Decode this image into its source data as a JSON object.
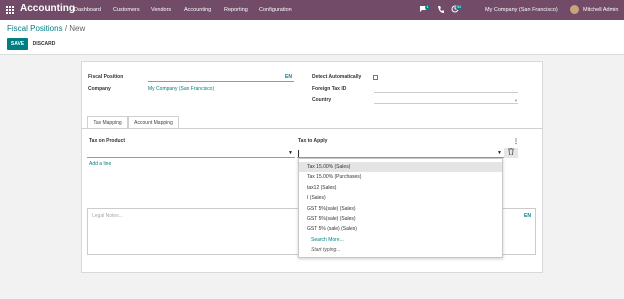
{
  "navbar": {
    "app_name": "Accounting",
    "menus": [
      "Dashboard",
      "Customers",
      "Vendors",
      "Accounting",
      "Reporting",
      "Configuration"
    ],
    "messages_badge": "4",
    "activities_badge": "34",
    "company": "My Company (San Francisco)",
    "user": "Mitchell Admin",
    "icons": [
      "apps-grid-icon",
      "chat-icon",
      "phone-icon",
      "clock-icon",
      "user-avatar"
    ]
  },
  "breadcrumb": {
    "parent": "Fiscal Positions",
    "separator": "/",
    "current": "New"
  },
  "buttons": {
    "save": "SAVE",
    "discard": "DISCARD"
  },
  "form": {
    "fiscal_position_label": "Fiscal Position",
    "fiscal_position_value": "",
    "lang_tag": "EN",
    "company_label": "Company",
    "company_value": "My Company (San Francisco)",
    "detect_label": "Detect Automatically",
    "detect_checked": false,
    "foreign_tax_label": "Foreign Tax ID",
    "foreign_tax_value": "",
    "country_label": "Country",
    "country_value": ""
  },
  "tabs": [
    "Tax Mapping",
    "Account Mapping"
  ],
  "tax_mapping": {
    "col_tax_on_product": "Tax on Product",
    "col_tax_to_apply": "Tax to Apply",
    "add_line": "Add a line"
  },
  "notes": {
    "placeholder": "Legal Notes...",
    "lang": "EN"
  },
  "dropdown": {
    "items": [
      "Tax 15.00% (Sales)",
      "Tax 15.00% (Purchases)",
      "tax12 (Sales)",
      "I (Sales)",
      "GST 5%(sale) (Sales)",
      "GST 5%(sale) (Sales)",
      "GST 5% (sale) (Sales)"
    ],
    "search_more": "Search More...",
    "hint": "Start typing..."
  },
  "colors": {
    "brand": "#714b67",
    "accent": "#017e84"
  }
}
